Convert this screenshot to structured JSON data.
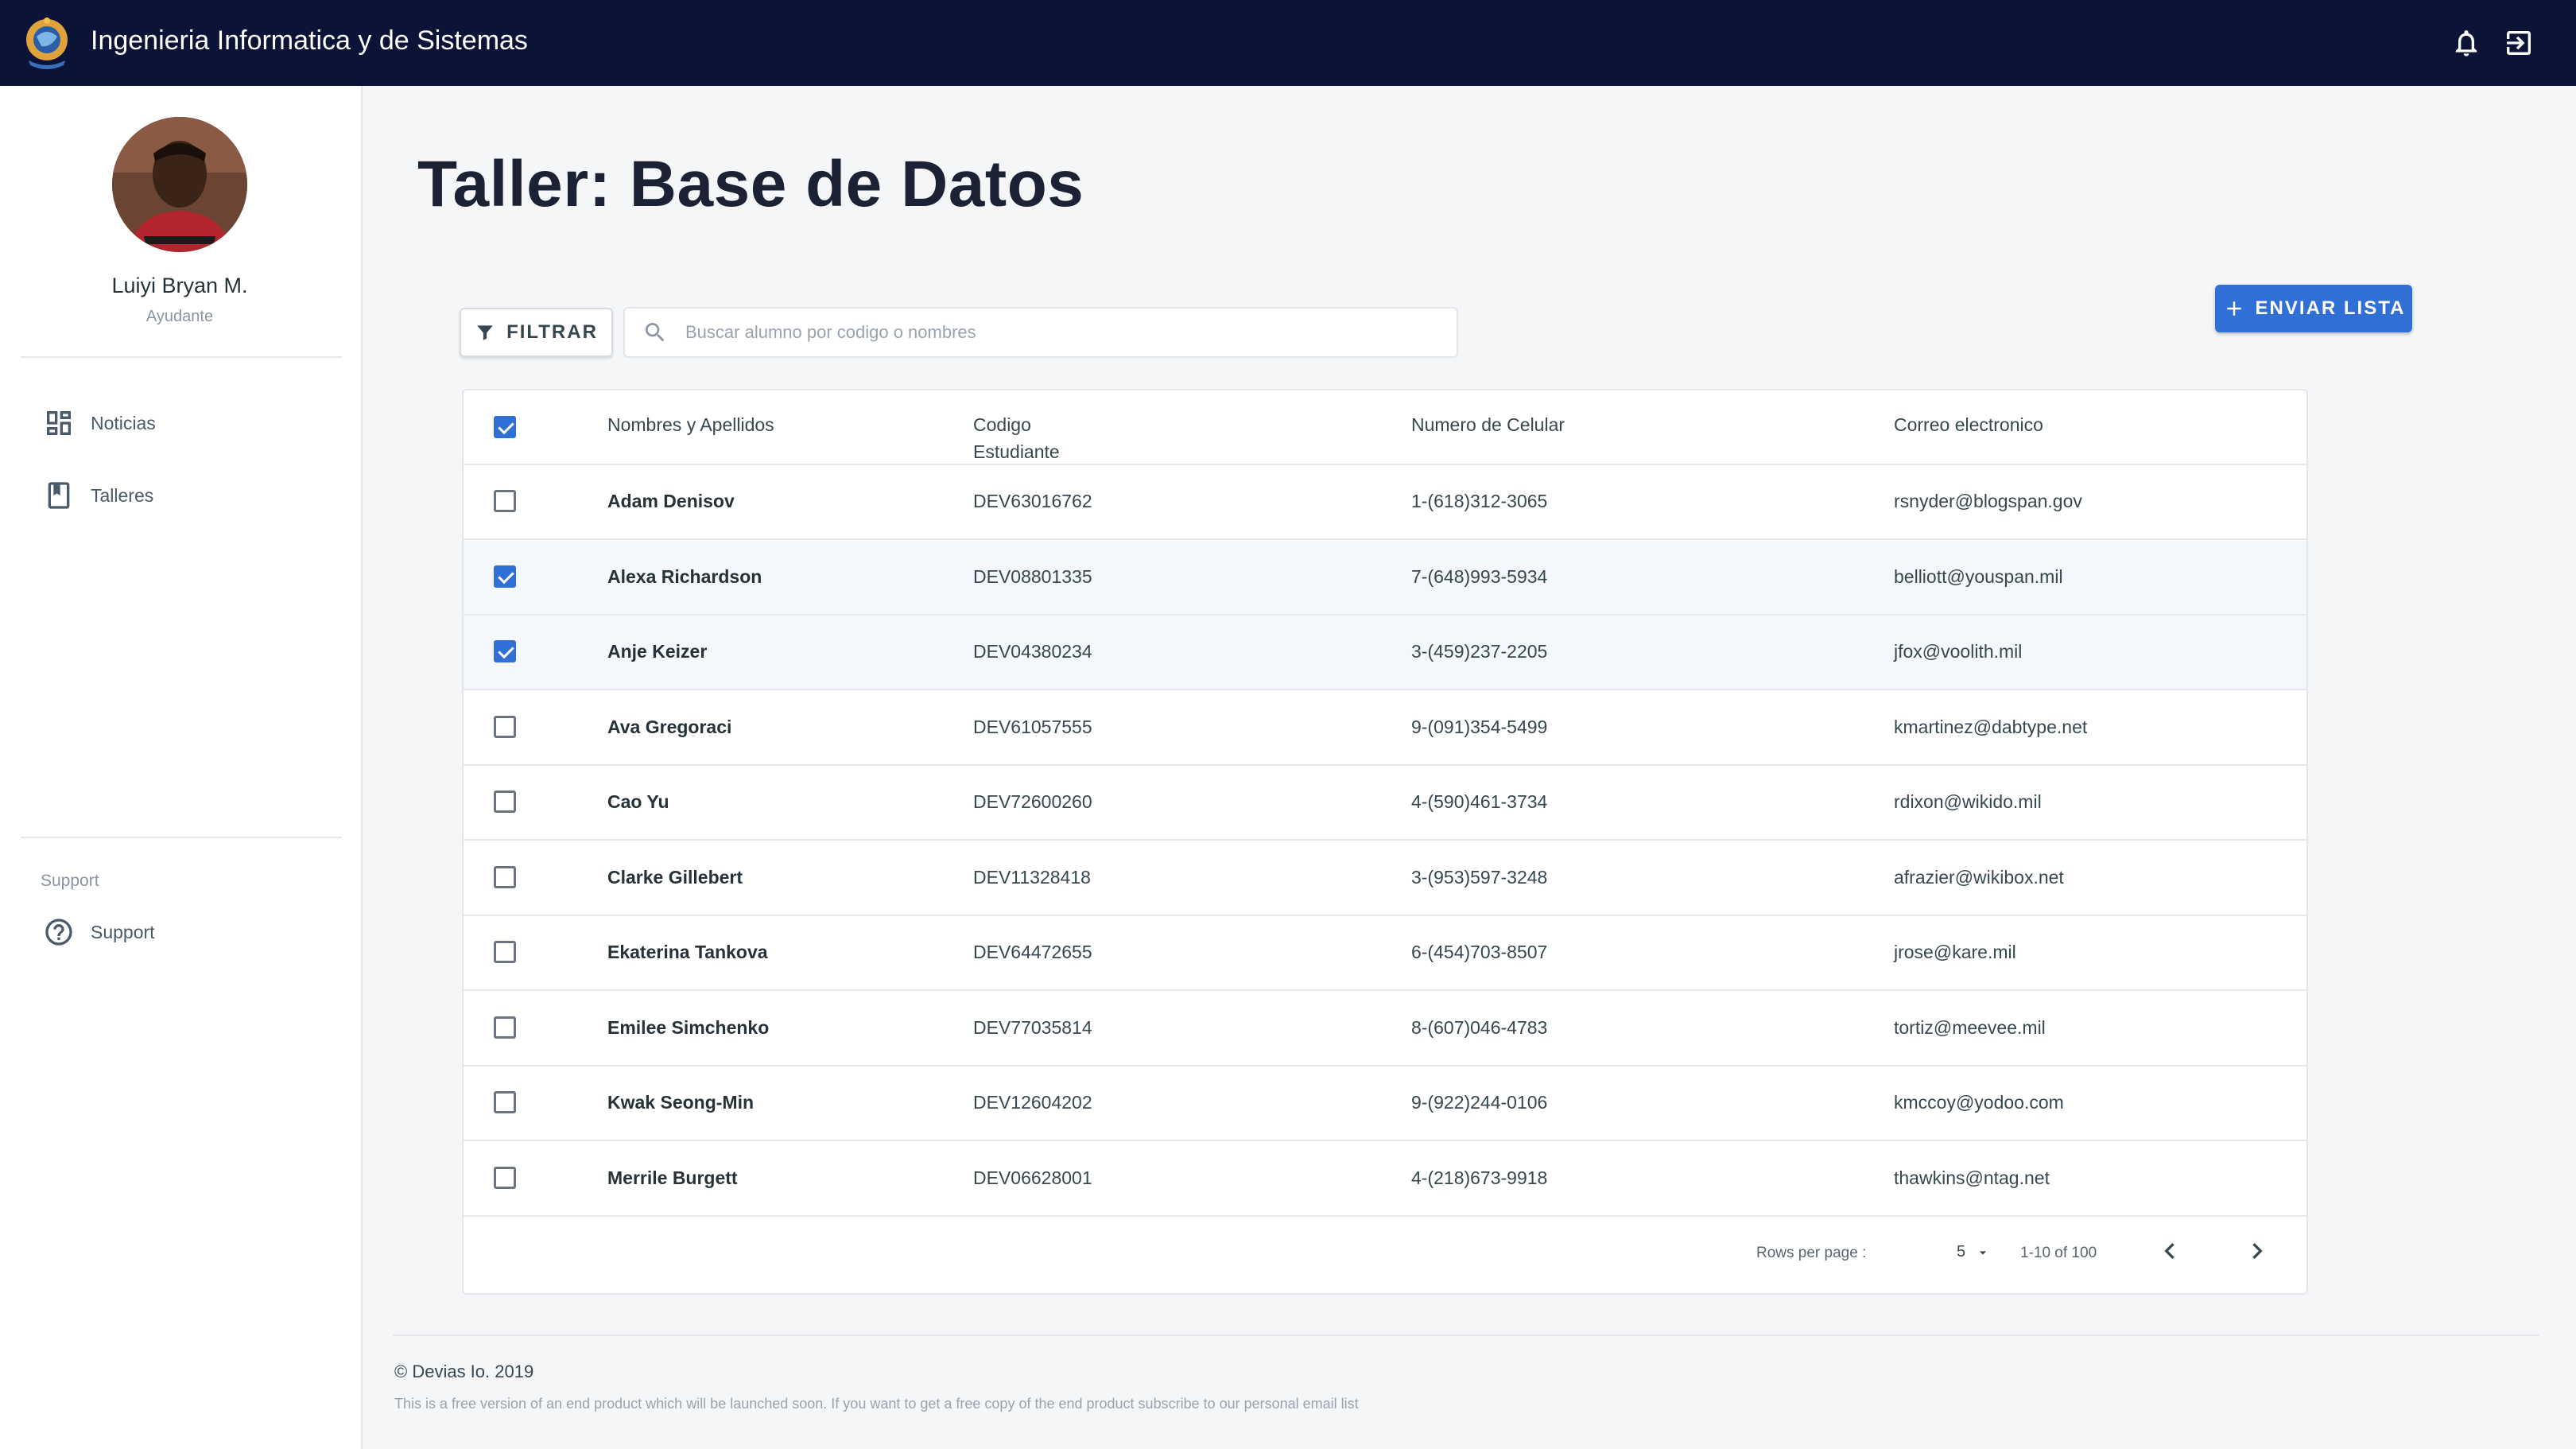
{
  "header": {
    "app_title": "Ingenieria Informatica y de Sistemas",
    "logo_icon": "university-logo",
    "notifications_icon": "bell-icon",
    "logout_icon": "logout-icon",
    "background_color": "#0b1437"
  },
  "sidebar": {
    "user": {
      "name": "Luiyi Bryan M.",
      "role": "Ayudante"
    },
    "items": [
      {
        "label": "Noticias",
        "icon": "dashboard-icon"
      },
      {
        "label": "Talleres",
        "icon": "book-icon"
      }
    ],
    "support_heading": "Support",
    "support_item": {
      "label": "Support",
      "icon": "help-circle-icon"
    }
  },
  "main": {
    "title": "Taller: Base de Datos",
    "filter_label": "FILTRAR",
    "search_placeholder": "Buscar alumno por codigo o nombres",
    "send_label": "ENVIAR LISTA",
    "accent_color": "#2f6fd6"
  },
  "table": {
    "header_all_checked": true,
    "columns": [
      "Nombres y Apellidos",
      "Codigo\nEstudiante",
      "Numero de Celular",
      "Correo electronico"
    ],
    "rows": [
      {
        "checked": false,
        "name": "Adam Denisov",
        "code": "DEV63016762",
        "phone": "1-(618)312-3065",
        "email": "rsnyder@blogspan.gov"
      },
      {
        "checked": true,
        "name": "Alexa Richardson",
        "code": "DEV08801335",
        "phone": "7-(648)993-5934",
        "email": "belliott@youspan.mil"
      },
      {
        "checked": true,
        "name": "Anje Keizer",
        "code": "DEV04380234",
        "phone": "3-(459)237-2205",
        "email": "jfox@voolith.mil"
      },
      {
        "checked": false,
        "name": "Ava Gregoraci",
        "code": "DEV61057555",
        "phone": "9-(091)354-5499",
        "email": "kmartinez@dabtype.net"
      },
      {
        "checked": false,
        "name": "Cao Yu",
        "code": "DEV72600260",
        "phone": "4-(590)461-3734",
        "email": "rdixon@wikido.mil"
      },
      {
        "checked": false,
        "name": "Clarke Gillebert",
        "code": "DEV11328418",
        "phone": "3-(953)597-3248",
        "email": "afrazier@wikibox.net"
      },
      {
        "checked": false,
        "name": "Ekaterina Tankova",
        "code": "DEV64472655",
        "phone": "6-(454)703-8507",
        "email": "jrose@kare.mil"
      },
      {
        "checked": false,
        "name": "Emilee Simchenko",
        "code": "DEV77035814",
        "phone": "8-(607)046-4783",
        "email": "tortiz@meevee.mil"
      },
      {
        "checked": false,
        "name": "Kwak Seong-Min",
        "code": "DEV12604202",
        "phone": "9-(922)244-0106",
        "email": "kmccoy@yodoo.com"
      },
      {
        "checked": false,
        "name": "Merrile Burgett",
        "code": "DEV06628001",
        "phone": "4-(218)673-9918",
        "email": "thawkins@ntag.net"
      }
    ],
    "pagination": {
      "rows_per_page_label": "Rows per page :",
      "rows_per_page": "5",
      "range": "1-10 of 100"
    }
  },
  "footer": {
    "copyright": "© Devias Io. 2019",
    "note": "This is a free version of an end product which will be launched soon. If you want to get a free copy of the end product subscribe to our personal email list"
  }
}
